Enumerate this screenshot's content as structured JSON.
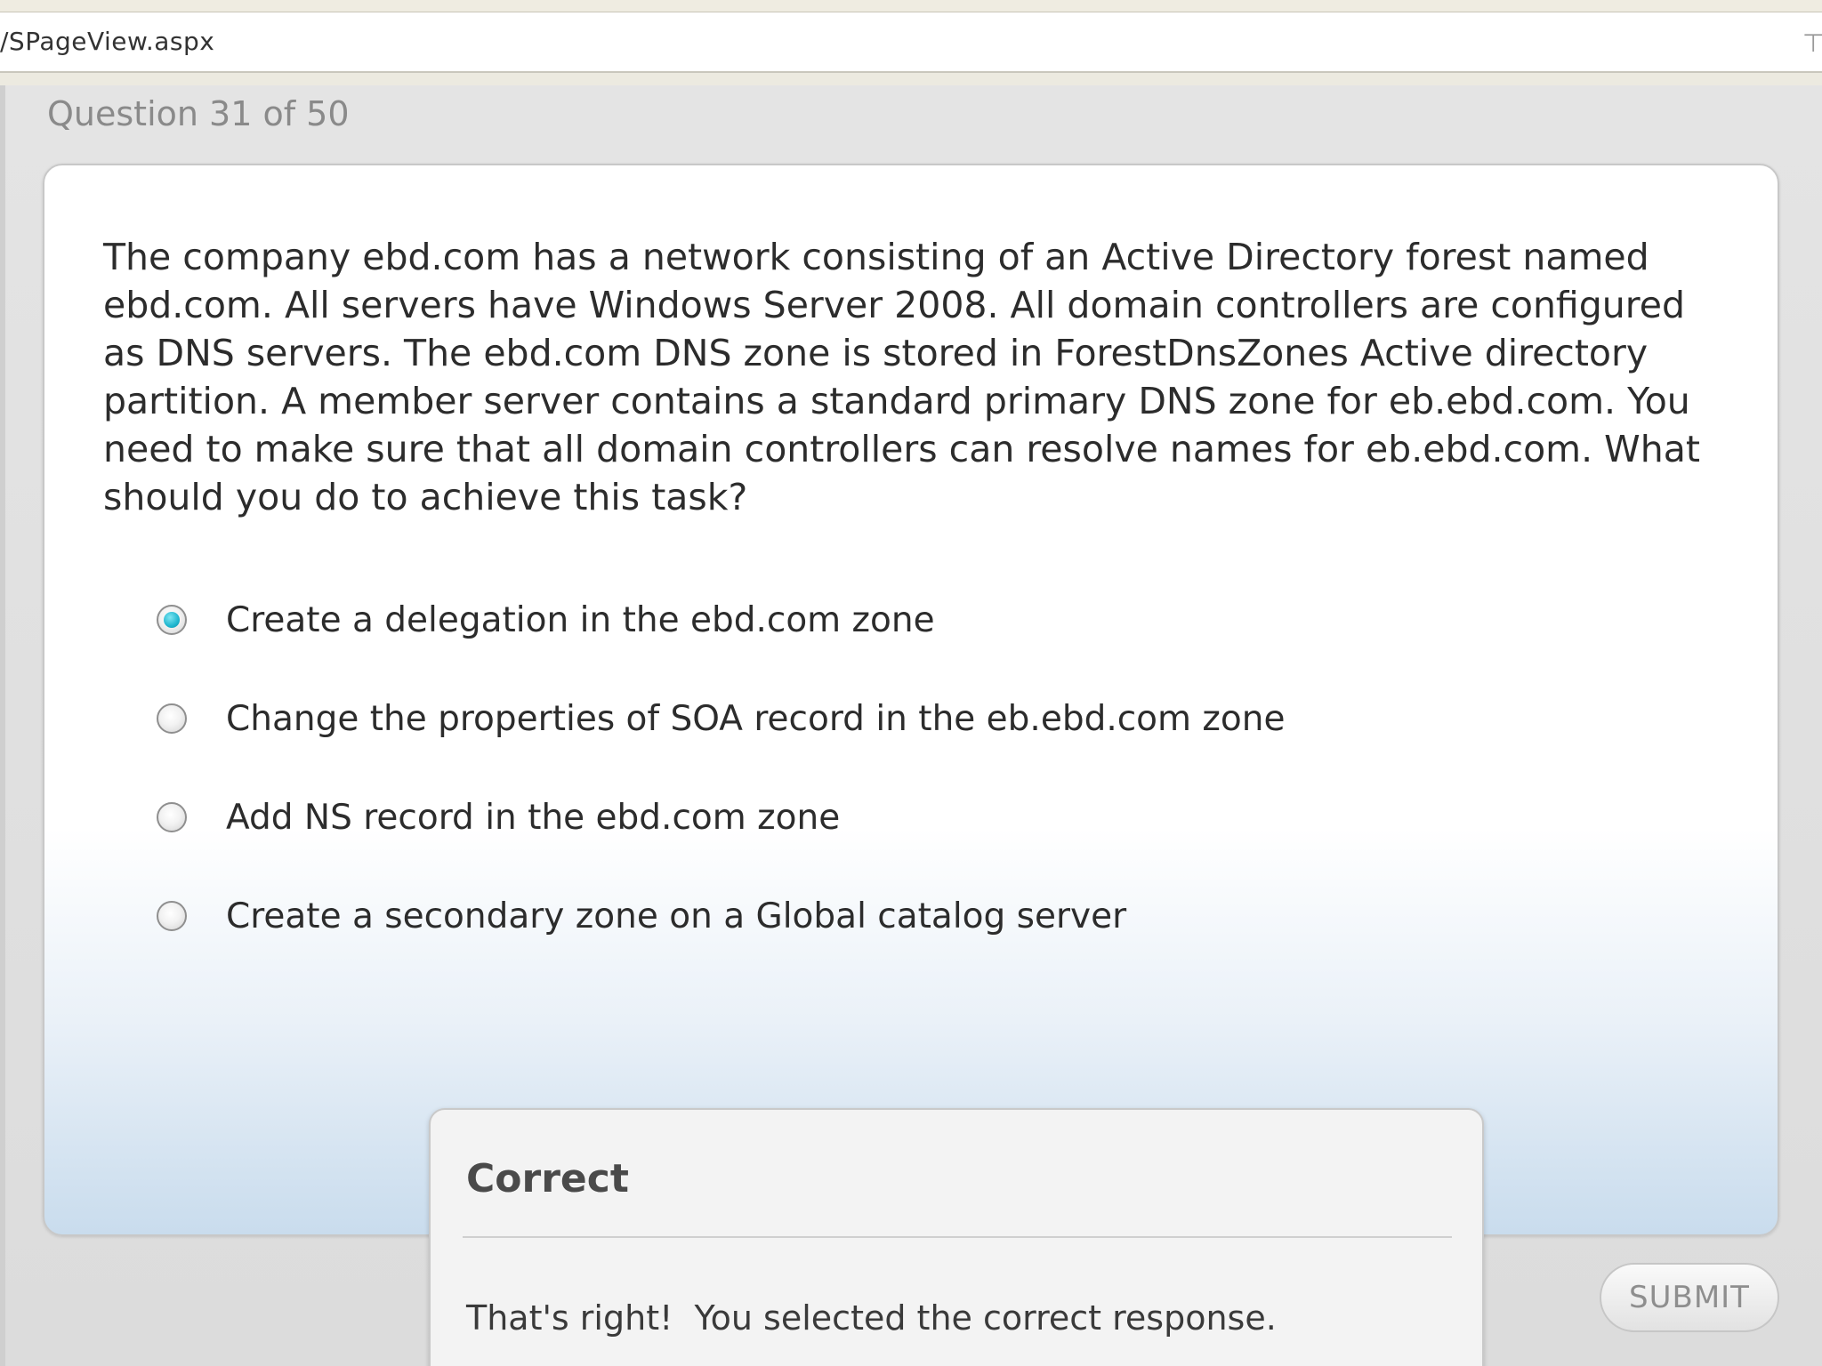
{
  "browser": {
    "url_fragment": "/SPageView.aspx",
    "right_icon": "funnel-icon"
  },
  "quiz": {
    "counter": "Question 31 of 50",
    "question_text": "The company ebd.com has a network consisting of an Active Directory forest named ebd.com. All servers have Windows Server 2008. All domain controllers are configured as DNS servers. The ebd.com DNS zone is stored in ForestDnsZones Active directory partition. A member server contains a standard primary DNS zone for eb.ebd.com. You need to make sure that all domain controllers can resolve names for eb.ebd.com. What should you do to achieve this task?",
    "options": [
      {
        "label": "Create a delegation in the ebd.com zone",
        "selected": true
      },
      {
        "label": "Change the properties of SOA record in the eb.ebd.com zone",
        "selected": false
      },
      {
        "label": "Add NS record in the ebd.com zone",
        "selected": false
      },
      {
        "label": "Create a secondary zone on a Global catalog server",
        "selected": false
      }
    ],
    "submit_label": "SUBMIT",
    "selected_color": "#1fb6cf"
  },
  "feedback": {
    "title": "Correct",
    "message": "That's right!  You selected the correct response."
  }
}
